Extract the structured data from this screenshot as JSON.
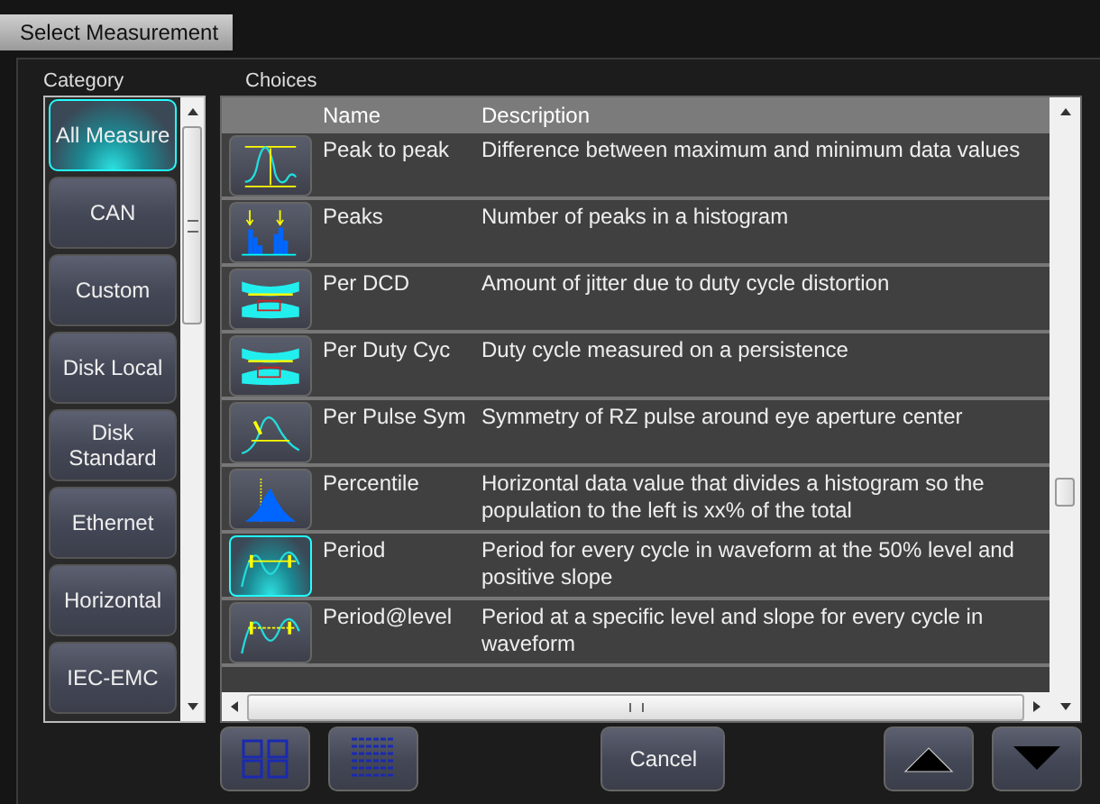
{
  "window": {
    "title": "Select Measurement"
  },
  "category": {
    "label": "Category",
    "items": [
      {
        "label": "All Measure",
        "selected": true
      },
      {
        "label": "CAN",
        "selected": false
      },
      {
        "label": "Custom",
        "selected": false
      },
      {
        "label": "Disk Local",
        "selected": false
      },
      {
        "label": "Disk Standard",
        "selected": false
      },
      {
        "label": "Ethernet",
        "selected": false
      },
      {
        "label": "Horizontal",
        "selected": false
      },
      {
        "label": "IEC-EMC",
        "selected": false
      }
    ]
  },
  "choices": {
    "label": "Choices",
    "columns": [
      "Name",
      "Description"
    ],
    "rows": [
      {
        "name": "Peak to peak",
        "description": "Difference between maximum and minimum data values",
        "selected": false
      },
      {
        "name": "Peaks",
        "description": "Number of peaks in a histogram",
        "selected": false
      },
      {
        "name": "Per DCD",
        "description": "Amount of jitter due to duty cycle distortion",
        "selected": false
      },
      {
        "name": "Per Duty Cyc",
        "description": "Duty cycle measured on a persistence",
        "selected": false
      },
      {
        "name": "Per Pulse Sym",
        "description": "Symmetry of RZ pulse around eye aperture center",
        "selected": false
      },
      {
        "name": "Percentile",
        "description": "Horizontal data value that divides a histogram so the population to the left is xx% of the total",
        "selected": false
      },
      {
        "name": "Period",
        "description": "Period for every cycle in waveform at the 50% level and positive slope",
        "selected": true
      },
      {
        "name": "Period@level",
        "description": "Period at a specific level and slope for every cycle in waveform",
        "selected": false
      }
    ]
  },
  "buttons": {
    "cancel": "Cancel"
  }
}
